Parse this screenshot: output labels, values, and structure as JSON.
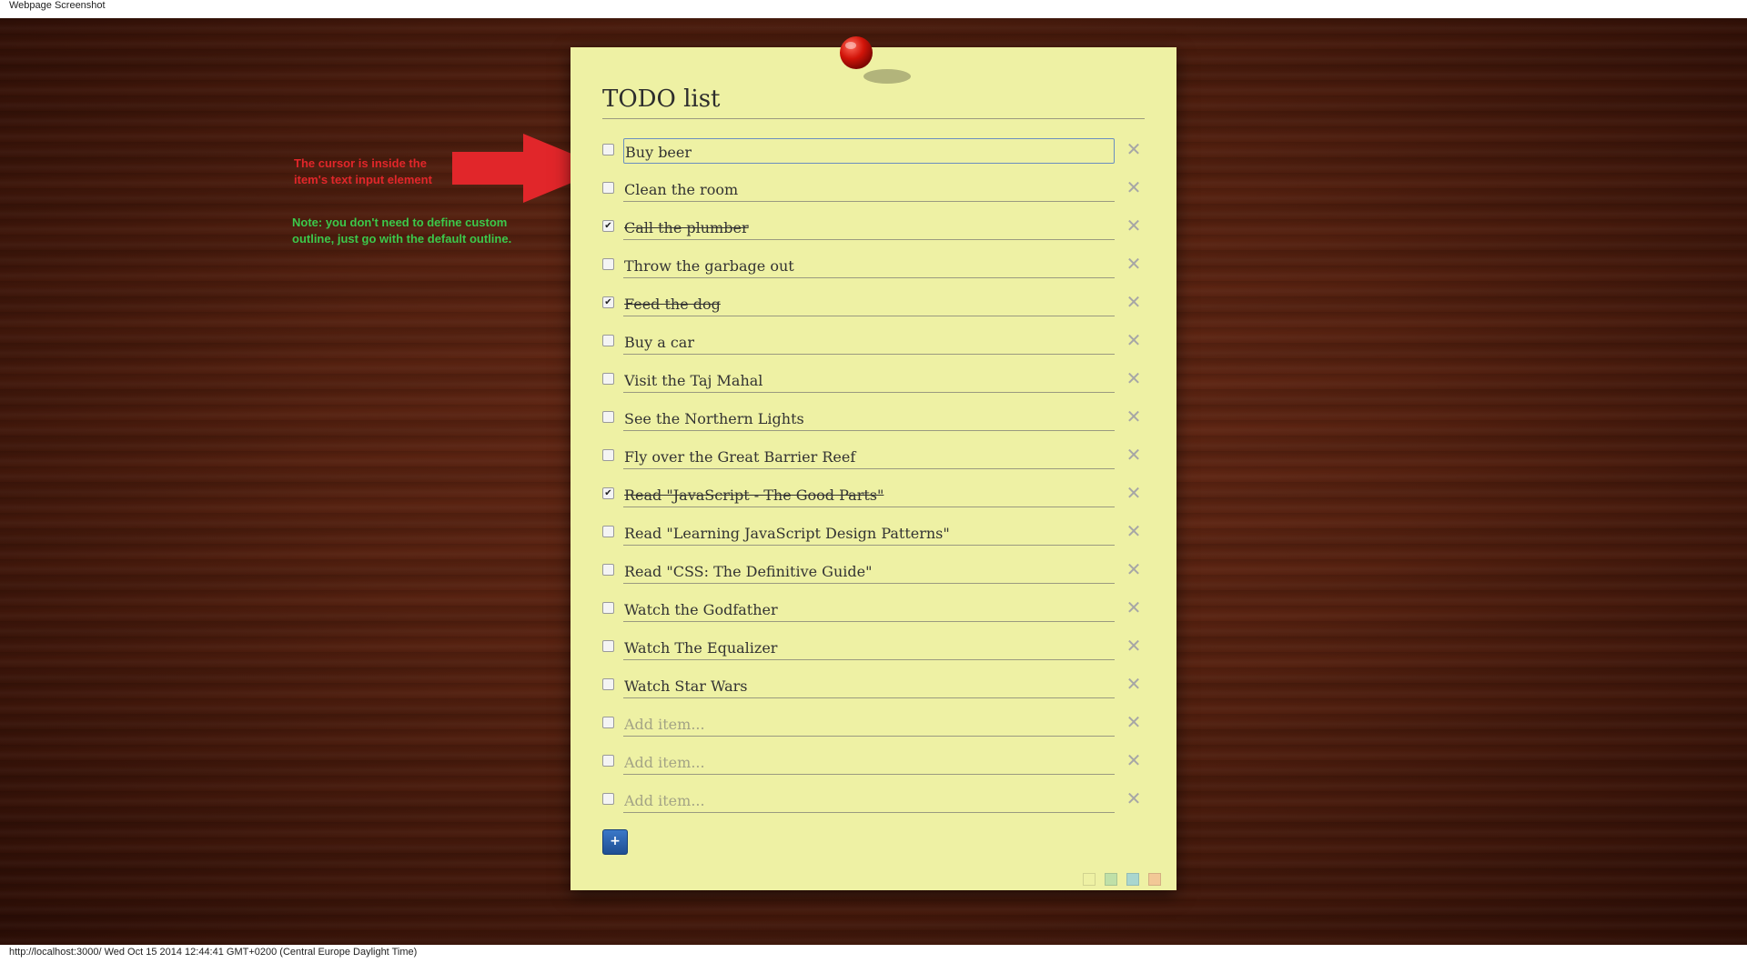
{
  "window": {
    "title": "Webpage Screenshot"
  },
  "annotations": {
    "red_lines": [
      "The cursor is inside the",
      "item's text input element"
    ],
    "green_lines": [
      "Note: you don't need to define custom",
      "outline, just go with the default outline."
    ]
  },
  "note": {
    "title": "TODO list",
    "items": [
      {
        "text": "Buy beer",
        "checked": false,
        "focused": true
      },
      {
        "text": "Clean the room",
        "checked": false
      },
      {
        "text": "Call the plumber",
        "checked": true
      },
      {
        "text": "Throw the garbage out",
        "checked": false
      },
      {
        "text": "Feed the dog",
        "checked": true
      },
      {
        "text": "Buy a car",
        "checked": false
      },
      {
        "text": "Visit the Taj Mahal",
        "checked": false
      },
      {
        "text": "See the Northern Lights",
        "checked": false
      },
      {
        "text": "Fly over the Great Barrier Reef",
        "checked": false
      },
      {
        "text": "Read \"JavaScript - The Good Parts\"",
        "checked": true
      },
      {
        "text": "Read \"Learning JavaScript Design Patterns\"",
        "checked": false
      },
      {
        "text": "Read \"CSS: The Definitive Guide\"",
        "checked": false
      },
      {
        "text": "Watch the Godfather",
        "checked": false
      },
      {
        "text": "Watch The Equalizer",
        "checked": false
      },
      {
        "text": "Watch Star Wars",
        "checked": false
      },
      {
        "text": "",
        "placeholder": "Add item...",
        "checked": false
      },
      {
        "text": "",
        "placeholder": "Add item...",
        "checked": false
      },
      {
        "text": "",
        "placeholder": "Add item...",
        "checked": false
      }
    ],
    "add_button_label": "+",
    "swatch_colors": [
      "#eef1a4",
      "#bfe0a8",
      "#a9d6cf",
      "#f2c896"
    ]
  },
  "colors": {
    "note_background": "#eef1a4",
    "annotation_red": "#e1262a",
    "annotation_green": "#3cc84b",
    "focus_outline": "#6a8ec0"
  },
  "footer": {
    "status": "http://localhost:3000/ Wed Oct 15 2014 12:44:41 GMT+0200 (Central Europe Daylight Time)"
  }
}
